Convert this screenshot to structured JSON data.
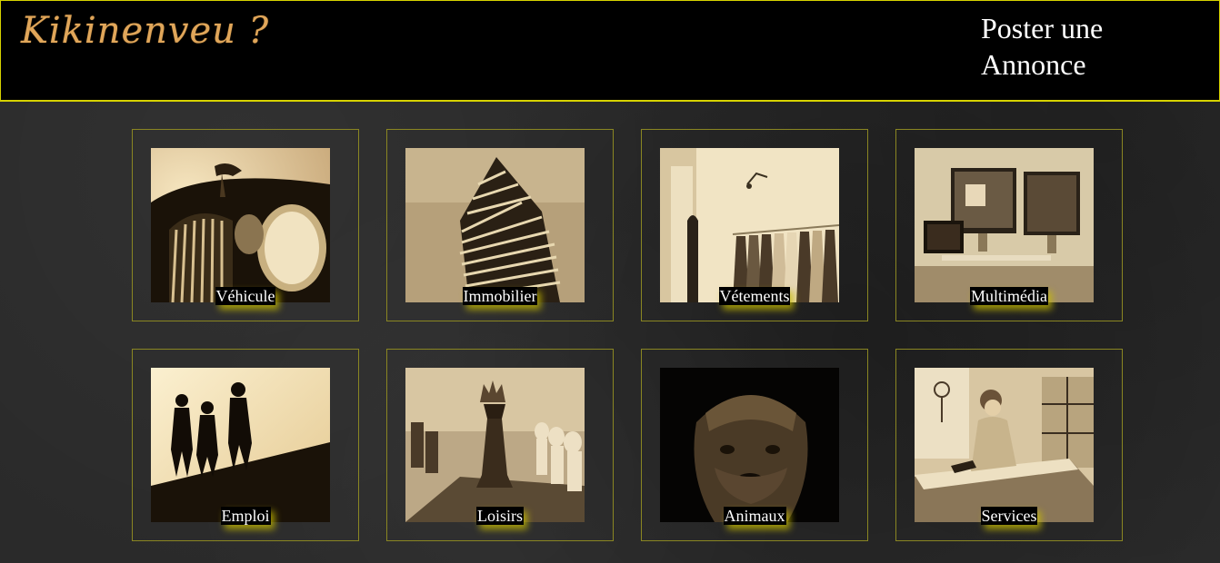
{
  "header": {
    "logo_text": "Kikinenveu ?",
    "post_link": "Poster une Annonce"
  },
  "categories": [
    {
      "label": "Véhicule",
      "image": "car-grille-headlight"
    },
    {
      "label": "Immobilier",
      "image": "tower-building"
    },
    {
      "label": "Vétements",
      "image": "clothing-rack"
    },
    {
      "label": "Multimédia",
      "image": "computer-monitors"
    },
    {
      "label": "Emploi",
      "image": "workers-silhouette"
    },
    {
      "label": "Loisirs",
      "image": "chess-king"
    },
    {
      "label": "Animaux",
      "image": "dog-face"
    },
    {
      "label": "Services",
      "image": "woman-ironing"
    }
  ],
  "colors": {
    "header_bg": "#000000",
    "header_border": "#d6d200",
    "logo": "#e0a65a",
    "card_border": "#8a8622",
    "label_glow": "#c8be00",
    "page_bg": "#2a2a2a"
  }
}
